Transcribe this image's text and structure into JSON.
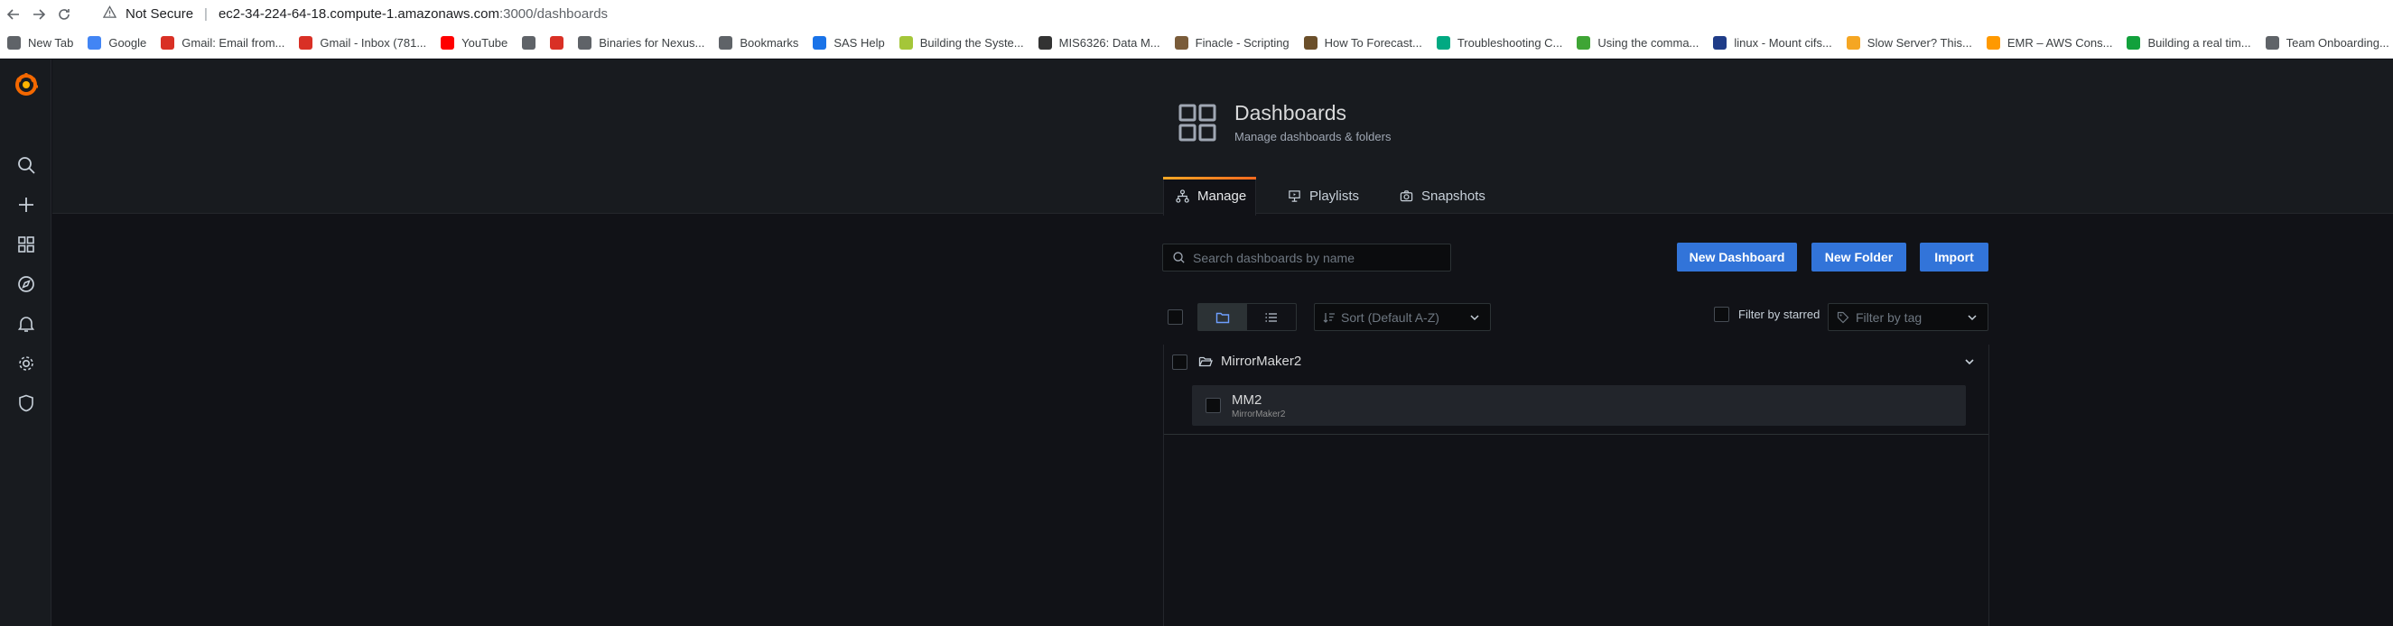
{
  "browser": {
    "security_label": "Not Secure",
    "url_host": "ec2-34-224-64-18.compute-1.amazonaws.com",
    "url_path": ":3000/dashboards"
  },
  "bookmarks": [
    {
      "label": "New Tab",
      "icon": "globe-icon",
      "color": "#5f6368"
    },
    {
      "label": "Google",
      "icon": "google-icon",
      "color": "#4285f4"
    },
    {
      "label": "Gmail: Email from...",
      "icon": "gmail-icon",
      "color": "#d93025"
    },
    {
      "label": "Gmail - Inbox (781...",
      "icon": "gmail-icon",
      "color": "#d93025"
    },
    {
      "label": "YouTube",
      "icon": "youtube-icon",
      "color": "#ff0000"
    },
    {
      "label": "",
      "icon": "search-icon",
      "color": "#5f6368"
    },
    {
      "label": "",
      "icon": "gmail-icon",
      "color": "#d93025"
    },
    {
      "label": "Binaries for Nexus...",
      "icon": "code-icon",
      "color": "#5f6368"
    },
    {
      "label": "Bookmarks",
      "icon": "star-icon",
      "color": "#5f6368"
    },
    {
      "label": "SAS Help",
      "icon": "sas-icon",
      "color": "#1a73e8"
    },
    {
      "label": "Building the Syste...",
      "icon": "android-icon",
      "color": "#a4c639"
    },
    {
      "label": "MIS6326: Data M...",
      "icon": "course-icon",
      "color": "#333333"
    },
    {
      "label": "Finacle - Scripting",
      "icon": "finacle-icon",
      "color": "#7a5c3a"
    },
    {
      "label": "How To Forecast...",
      "icon": "article-icon",
      "color": "#6b4f2a"
    },
    {
      "label": "Troubleshooting C...",
      "icon": "hpe-icon",
      "color": "#01a982"
    },
    {
      "label": "Using the comma...",
      "icon": "tip-icon",
      "color": "#3fa535"
    },
    {
      "label": "linux - Mount cifs...",
      "icon": "unix-icon",
      "color": "#1f3c88"
    },
    {
      "label": "Slow Server? This...",
      "icon": "blog-icon",
      "color": "#f5a623"
    },
    {
      "label": "EMR – AWS Cons...",
      "icon": "aws-icon",
      "color": "#ff9900"
    },
    {
      "label": "Building a real tim...",
      "icon": "medium-icon",
      "color": "#12a13c"
    },
    {
      "label": "Team Onboarding...",
      "icon": "globe-icon",
      "color": "#5f6368"
    },
    {
      "label": "",
      "icon": "wiki-icon",
      "color": "#3a5ba0"
    }
  ],
  "page_header": {
    "title": "Dashboards",
    "subtitle": "Manage dashboards & folders",
    "icon": "apps-grid-icon"
  },
  "tabs": [
    {
      "label": "Manage",
      "icon": "sitemap-icon",
      "active": true
    },
    {
      "label": "Playlists",
      "icon": "presentation-play-icon",
      "active": false
    },
    {
      "label": "Snapshots",
      "icon": "camera-icon",
      "active": false
    }
  ],
  "search": {
    "placeholder": "Search dashboards by name",
    "value": ""
  },
  "actions": {
    "new_dashboard": "New Dashboard",
    "new_folder": "New Folder",
    "import": "Import"
  },
  "filters": {
    "sort_placeholder": "Sort (Default A-Z)",
    "starred_label": "Filter by starred",
    "tag_placeholder": "Filter by tag"
  },
  "folders": [
    {
      "name": "MirrorMaker2",
      "expanded": true,
      "dashboards": [
        {
          "name": "MM2",
          "folder": "MirrorMaker2"
        }
      ]
    }
  ],
  "colors": {
    "accent": "#3274d9",
    "tab_underline": "#ff6a1e",
    "logo": "#f46800"
  }
}
